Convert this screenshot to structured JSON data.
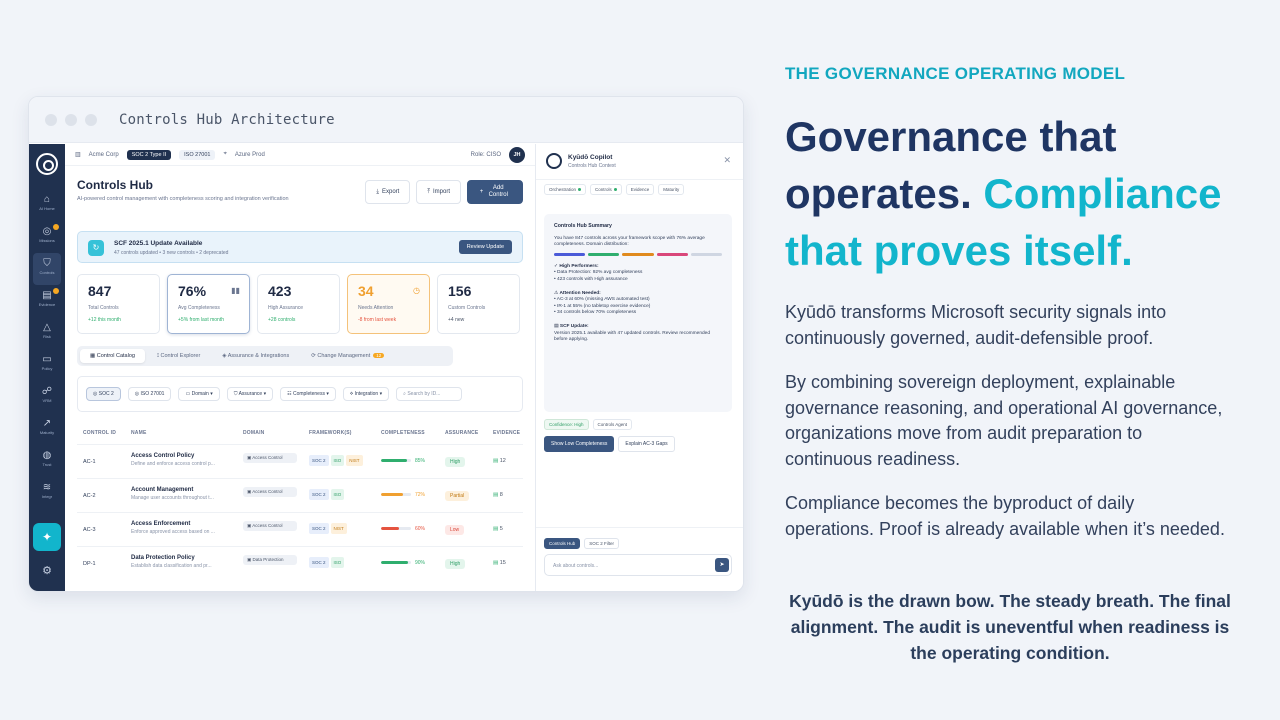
{
  "window": {
    "title": "Controls Hub Architecture"
  },
  "sidebar": {
    "items": [
      {
        "icon": "home-icon",
        "glyph": "⌂",
        "label": "AI Home"
      },
      {
        "icon": "mission-icon",
        "glyph": "◎",
        "label": "Missions"
      },
      {
        "icon": "shield-icon",
        "glyph": "⛉",
        "label": "Controls"
      },
      {
        "icon": "file-icon",
        "glyph": "▤",
        "label": "Evidence"
      },
      {
        "icon": "alert-icon",
        "glyph": "△",
        "label": "Risk"
      },
      {
        "icon": "doc-icon",
        "glyph": "▭",
        "label": "Policy"
      },
      {
        "icon": "users-icon",
        "glyph": "☍",
        "label": "VRM"
      },
      {
        "icon": "chart-icon",
        "glyph": "↗",
        "label": "Maturity"
      },
      {
        "icon": "globe-icon",
        "glyph": "◍",
        "label": "Trust"
      },
      {
        "icon": "layers-icon",
        "glyph": "≋",
        "label": "Integr"
      }
    ]
  },
  "topbar": {
    "org": "Acme Corp",
    "frameworks": [
      "SOC 2 Type II",
      "ISO 27001"
    ],
    "env": "Azure Prod",
    "role": "Role: CISO",
    "avatar": "JH"
  },
  "page": {
    "title": "Controls Hub",
    "subtitle": "AI-powered control management with completeness scoring and integration verification",
    "buttons": {
      "export": "Export",
      "import": "Import",
      "add": "Add Control"
    }
  },
  "banner": {
    "title": "SCF 2025.1 Update Available",
    "subtitle": "47 controls updated • 3 new controls • 2 deprecated",
    "button": "Review Update"
  },
  "stats": [
    {
      "value": "847",
      "label": "Total Controls",
      "trend": "+12 this month"
    },
    {
      "value": "76%",
      "label": "Avg Completeness",
      "trend": "+5% from last month"
    },
    {
      "value": "423",
      "label": "High Assurance",
      "trend": "+28 controls"
    },
    {
      "value": "34",
      "label": "Needs Attention",
      "trend": "-8 from last week"
    },
    {
      "value": "156",
      "label": "Custom Controls",
      "trend": "+4 new"
    }
  ],
  "tabs": [
    "Control Catalog",
    "Control Explorer",
    "Assurance & Integrations",
    "Change Management"
  ],
  "tab_badge": "12",
  "filters": {
    "framework": "SOC 2",
    "framework2": "ISO 27001",
    "domain": "Domain",
    "assurance": "Assurance",
    "completeness": "Completeness",
    "integration": "Integration",
    "search": "Search by ID..."
  },
  "table": {
    "headers": [
      "CONTROL ID",
      "NAME",
      "DOMAIN",
      "FRAMEWORK(S)",
      "COMPLETENESS",
      "ASSURANCE",
      "EVIDENCE"
    ],
    "rows": [
      {
        "id": "AC-1",
        "name": "Access Control Policy",
        "desc": "Define and enforce access control p...",
        "domain": "Access Control",
        "fw": [
          "SOC 2",
          "ISO",
          "NIST"
        ],
        "pct": 85,
        "pct_label": "85%",
        "color": "#2fae6e",
        "assurance": "High",
        "cls": "h",
        "evidence": "12"
      },
      {
        "id": "AC-2",
        "name": "Account Management",
        "desc": "Manage user accounts throughout t...",
        "domain": "Access Control",
        "fw": [
          "SOC 2",
          "ISO"
        ],
        "pct": 72,
        "pct_label": "72%",
        "color": "#f0a030",
        "assurance": "Partial",
        "cls": "p",
        "evidence": "8"
      },
      {
        "id": "AC-3",
        "name": "Access Enforcement",
        "desc": "Enforce approved access based on ...",
        "domain": "Access Control",
        "fw": [
          "SOC 2",
          "NIST"
        ],
        "pct": 60,
        "pct_label": "60%",
        "color": "#e5533f",
        "assurance": "Low",
        "cls": "l",
        "evidence": "5"
      },
      {
        "id": "DP-1",
        "name": "Data Protection Policy",
        "desc": "Establish data classification and pr...",
        "domain": "Data Protection",
        "fw": [
          "SOC 2",
          "ISO"
        ],
        "pct": 90,
        "pct_label": "90%",
        "color": "#2fae6e",
        "assurance": "High",
        "cls": "h",
        "evidence": "15"
      }
    ]
  },
  "copilot": {
    "title": "Kyūdō Copilot",
    "subtitle": "Controls Hub Context",
    "tabs": [
      "Orchestration",
      "Controls",
      "Evidence",
      "Maturity"
    ],
    "summary_title": "Controls Hub Summary",
    "summary_intro": "You have 847 controls across your framework scope with 76% average completeness. Domain distribution:",
    "high_title": "✓ High Performers:",
    "high_items": [
      "• Data Protection: 92% avg completeness",
      "• 423 controls with High assurance"
    ],
    "att_title": "⚠ Attention Needed:",
    "att_items": [
      "• AC-3 at 60% (missing AWS automated test)",
      "• IR-1 at 55% (no tabletop exercise evidence)",
      "• 34 controls below 70% completeness"
    ],
    "scf_title": "▤ SCF Update:",
    "scf_text": "Version 2025.1 available with 47 updated controls. Review recommended before applying.",
    "confidence": "Confidence: High",
    "agent": "Controls Agent",
    "action1": "Show Low Completeness",
    "action2": "Explain AC-3 Gaps",
    "context_tags": [
      "Controls Hub",
      "SOC 2 Filter"
    ],
    "input_placeholder": "Ask about controls..."
  },
  "text": {
    "eyebrow": "THE GOVERNANCE OPERATING MODEL",
    "headline_a": "Governance that operates. ",
    "headline_b": "Compliance that proves itself.",
    "p1": "Kyūdō transforms Microsoft security signals into continuously governed, audit-defensible proof.",
    "p2": "By combining sovereign deployment, explainable governance reasoning, and operational AI governance, organizations move from audit preparation to continuous readiness.",
    "p3": "Compliance becomes the byproduct of daily operations. Proof is already available when it’s needed.",
    "quote": "Kyūdō is the drawn bow. The steady breath. The final alignment. The audit is uneventful when readiness is the operating condition."
  },
  "colors": {
    "navy": "#1f3563",
    "accent": "#12b5cc",
    "sidebar": "#20314f",
    "primary_button": "#3a5680"
  }
}
